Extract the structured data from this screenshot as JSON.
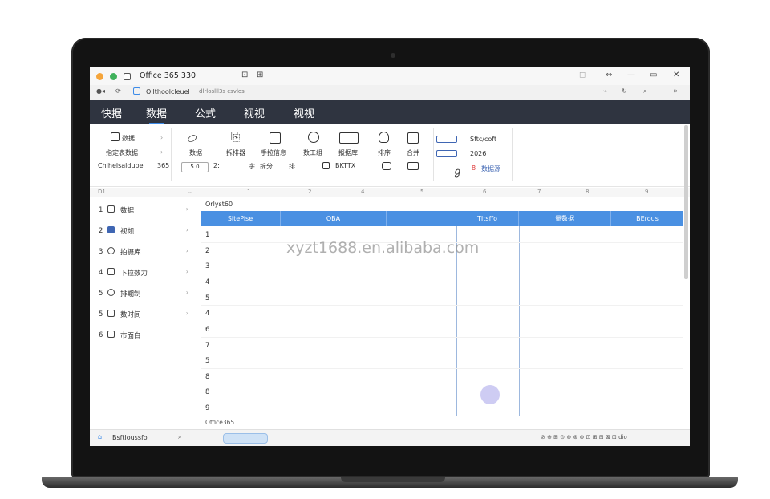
{
  "window": {
    "title": "Office 365  330",
    "address": "Oilthoolcleuel",
    "address_sub": "dlrloslll3s csvlos"
  },
  "menu": {
    "tabs": [
      "快据",
      "数据",
      "公式",
      "视视",
      "视视"
    ],
    "active_index": 1
  },
  "ribbon": {
    "left_group": [
      "数据",
      "指定表数据",
      "Chihelsaldupe"
    ],
    "left_value": "365",
    "left_field": "5 0",
    "left_field_after": "2:",
    "tool_labels": [
      "数据",
      "拆排器",
      "手拉信息",
      "数工组",
      "报据库",
      "排序",
      "合并"
    ],
    "row3_text": [
      "字",
      "拆分",
      "排",
      "BKTTX"
    ],
    "right_group": [
      "Sftc/coft",
      "2026",
      "数据源"
    ],
    "right_marker": "8"
  },
  "column_header": {
    "name_box": "D1",
    "cols": [
      "1",
      "2",
      "4",
      "5",
      "6",
      "7",
      "8",
      "9"
    ]
  },
  "sidebar": {
    "items": [
      {
        "num": "1",
        "icon": "table-icon",
        "label": "数据"
      },
      {
        "num": "2",
        "icon": "chart-icon",
        "label": "视频"
      },
      {
        "num": "3",
        "icon": "info-icon",
        "label": "拍摄库"
      },
      {
        "num": "4",
        "icon": "doc-icon",
        "label": "下拉数力"
      },
      {
        "num": "5",
        "icon": "calendar-icon",
        "label": "排期制"
      },
      {
        "num": "5",
        "icon": "clock-icon",
        "label": "数时间"
      },
      {
        "num": "6",
        "icon": "page-icon",
        "label": "市面白"
      }
    ]
  },
  "grid": {
    "label": "Orlyst60",
    "headers": [
      "SitePise",
      "OBA",
      "",
      "TItsffo",
      "量数据",
      "BErous"
    ],
    "row_numbers": [
      "1",
      "2",
      "3",
      "4",
      "5",
      "4",
      "6",
      "7",
      "5",
      "8",
      "8",
      "9"
    ],
    "footer": "Office365"
  },
  "taskbar": {
    "app_label": "Bsftloussfo",
    "tray": "⊘ ⊕ ⊞ ⊙ ⊚ ⊛ ⊜ ⊡ ⊞ ⊟ ⊠ ⊡ dio",
    "watermark": "xyzt1688.en.alibaba.com"
  },
  "colors": {
    "accent": "#4a90e2",
    "menubar": "#2f3440",
    "cursor": "#c9c7f2"
  }
}
